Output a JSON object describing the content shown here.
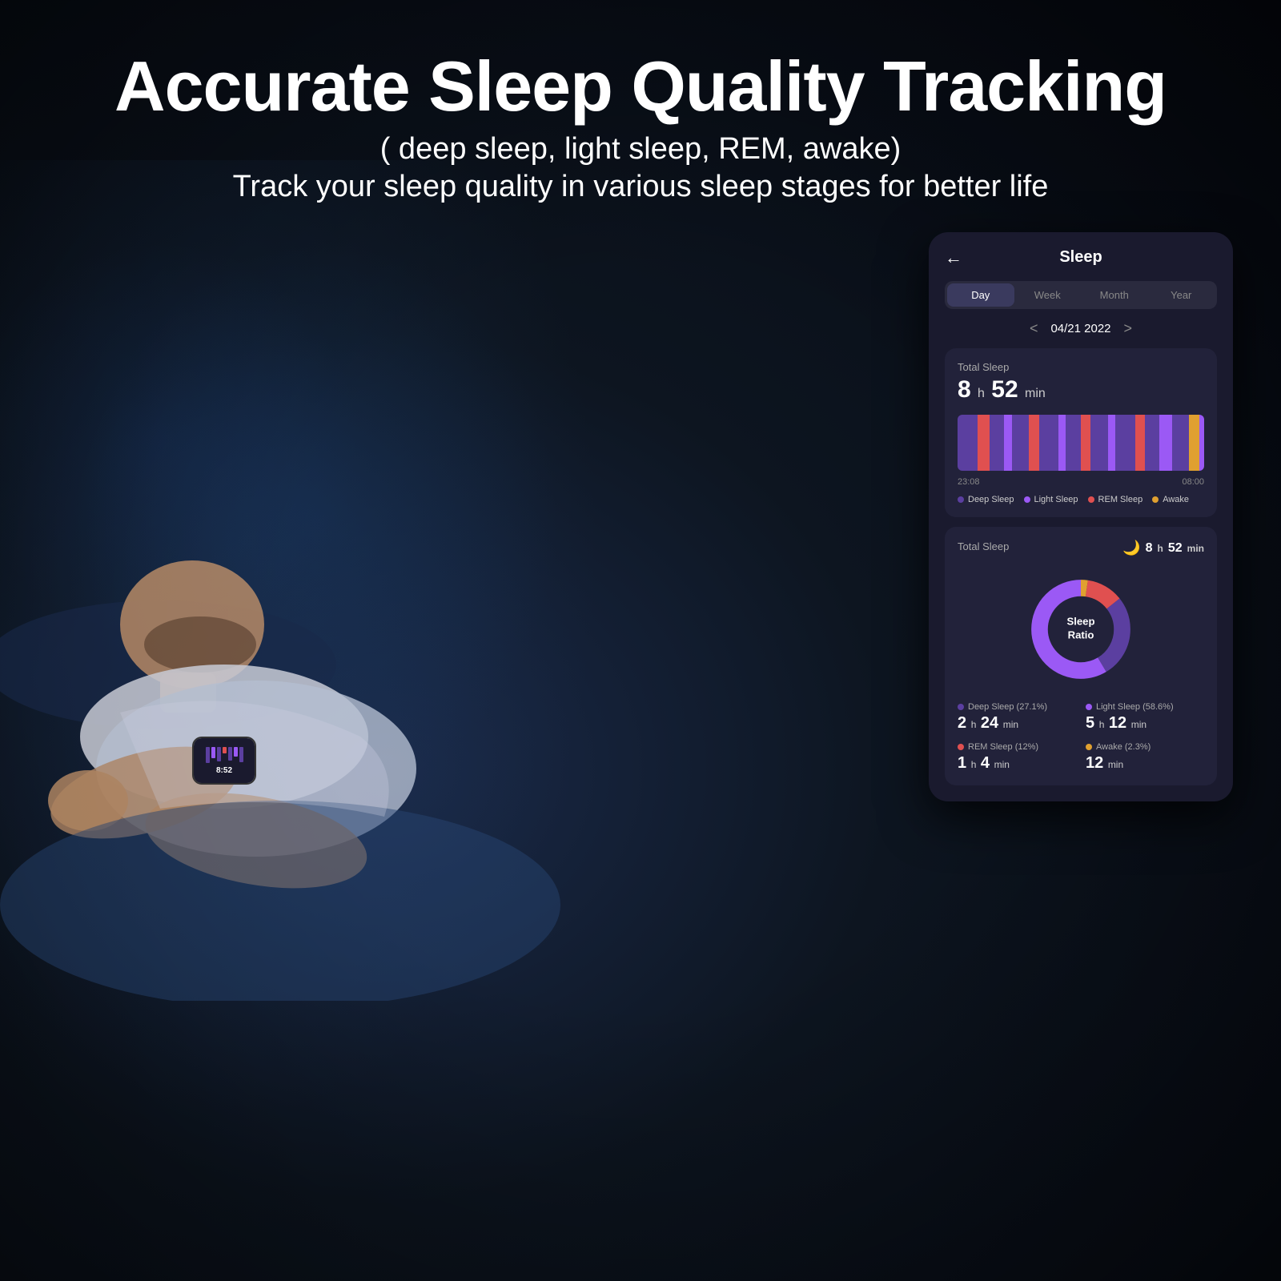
{
  "page": {
    "background": "#0a0e1a"
  },
  "header": {
    "main_title": "Accurate Sleep Quality Tracking",
    "subtitle_1": "( deep sleep, light sleep, REM, awake)",
    "subtitle_2": "Track your sleep quality in various sleep stages for better life"
  },
  "phone_ui": {
    "title": "Sleep",
    "back_label": "←",
    "tabs": [
      "Day",
      "Week",
      "Month",
      "Year"
    ],
    "active_tab": "Day",
    "date": "04/21 2022",
    "date_prev": "<",
    "date_next": ">",
    "total_sleep_label": "Total Sleep",
    "total_sleep_hours": "8",
    "total_sleep_unit_h": "h",
    "total_sleep_mins": "52",
    "total_sleep_unit_min": "min",
    "chart_start_time": "23:08",
    "chart_end_time": "08:00",
    "legend": [
      {
        "label": "Deep Sleep",
        "color": "#5b3fa0"
      },
      {
        "label": "Light Sleep",
        "color": "#9b59f5"
      },
      {
        "label": "REM Sleep",
        "color": "#e05050"
      },
      {
        "label": "Awake",
        "color": "#e0a030"
      }
    ],
    "sleep_ratio_section": {
      "label": "Total Sleep",
      "moon_icon": "🌙",
      "hours": "8",
      "unit_h": "h",
      "mins": "52",
      "unit_min": "min",
      "donut_center_line1": "Sleep",
      "donut_center_line2": "Ratio",
      "segments": [
        {
          "label": "Deep Sleep",
          "percent": 27.1,
          "color": "#5b3fa0",
          "sweep": 97.56
        },
        {
          "label": "Light Sleep",
          "percent": 58.6,
          "color": "#9b59f5",
          "sweep": 210.96
        },
        {
          "label": "REM Sleep",
          "percent": 12,
          "color": "#e05050",
          "sweep": 43.2
        },
        {
          "label": "Awake",
          "percent": 2.3,
          "color": "#e0a030",
          "sweep": 8.28
        }
      ],
      "ratio_items": [
        {
          "label": "Deep Sleep (27.1%)",
          "color": "#5b3fa0",
          "value": "2",
          "unit_h": "h",
          "mins": "24",
          "unit_min": "min"
        },
        {
          "label": "Light Sleep (58.6%)",
          "color": "#9b59f5",
          "value": "5",
          "unit_h": "h",
          "mins": "12",
          "unit_min": "min"
        },
        {
          "label": "REM Sleep (12%)",
          "color": "#e05050",
          "value": "1",
          "unit_h": "h",
          "mins": "4",
          "unit_min": "min"
        },
        {
          "label": "Awake (2.3%)",
          "color": "#e0a030",
          "value": "12",
          "unit_h": "",
          "mins": "",
          "unit_min": "min"
        }
      ]
    }
  },
  "watch": {
    "time": "8:52",
    "bars": [
      {
        "color": "#5b3fa0",
        "height": "100%"
      },
      {
        "color": "#9b59f5",
        "height": "70%"
      },
      {
        "color": "#5b3fa0",
        "height": "90%"
      },
      {
        "color": "#e05050",
        "height": "40%"
      },
      {
        "color": "#5b3fa0",
        "height": "85%"
      },
      {
        "color": "#9b59f5",
        "height": "60%"
      },
      {
        "color": "#5b3fa0",
        "height": "95%"
      }
    ]
  }
}
